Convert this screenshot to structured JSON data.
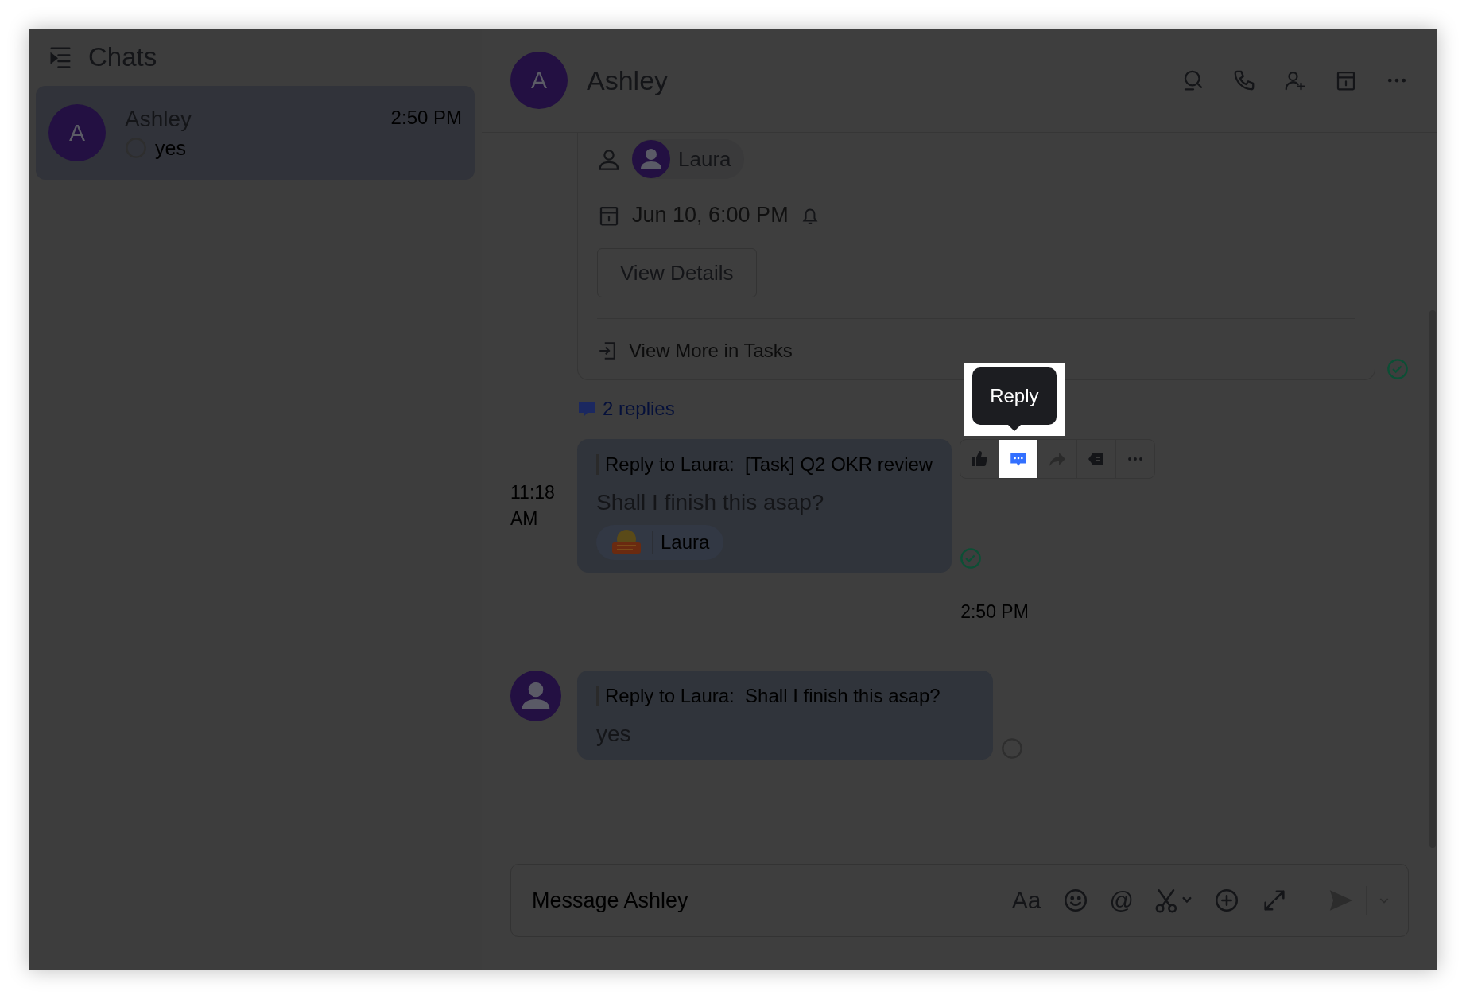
{
  "sidebar": {
    "title": "Chats",
    "chats": [
      {
        "avatar": "A",
        "name": "Ashley",
        "time": "2:50 PM",
        "preview": "yes",
        "read": false,
        "selected": true
      }
    ]
  },
  "chat": {
    "avatar": "A",
    "name": "Ashley",
    "actions": [
      {
        "kind": "search"
      },
      {
        "kind": "call"
      },
      {
        "kind": "add-member"
      },
      {
        "kind": "calendar"
      },
      {
        "kind": "more"
      }
    ]
  },
  "task_card": {
    "assignee": "Laura",
    "due": "Jun 10, 6:00 PM",
    "button": "View Details",
    "link": "View More in Tasks",
    "read": true,
    "replies": "2 replies"
  },
  "timeline": [
    {
      "kind": "message",
      "time": "11:18 AM",
      "show_avatar": false,
      "quote_label": "Reply to Laura:",
      "quote": "[Task] Q2 OKR review",
      "text": "Shall I finish this asap?",
      "reaction": {
        "user": "Laura"
      },
      "read": true,
      "tooltip": "Reply",
      "actions": [
        {
          "kind": "like",
          "selected": false
        },
        {
          "kind": "reply",
          "selected": true
        },
        {
          "kind": "forward",
          "selected": false
        },
        {
          "kind": "tag",
          "selected": false
        },
        {
          "kind": "more",
          "selected": false
        }
      ]
    },
    {
      "kind": "time",
      "text": "2:50 PM"
    },
    {
      "kind": "message",
      "show_avatar": true,
      "quote_label": "Reply to Laura:",
      "quote": "Shall I finish this asap?",
      "text": "yes",
      "read": false
    }
  ],
  "composer": {
    "placeholder": "Message Ashley",
    "tools": [
      {
        "kind": "format",
        "label": "Aa"
      },
      {
        "kind": "emoji"
      },
      {
        "kind": "mention",
        "label": "@"
      },
      {
        "kind": "scissors"
      },
      {
        "kind": "add"
      },
      {
        "kind": "expand"
      }
    ]
  }
}
